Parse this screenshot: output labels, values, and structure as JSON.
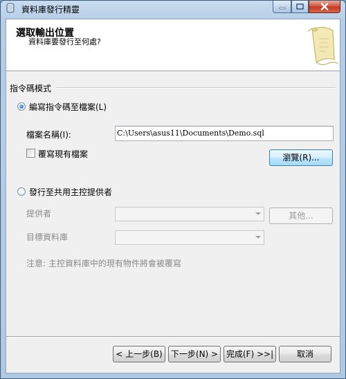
{
  "window": {
    "title": "資料庫發行精靈"
  },
  "header": {
    "title": "選取輸出位置",
    "subtitle": "資料庫要發行至何處?"
  },
  "script_mode": {
    "group_label": "指令碼模式",
    "option_file_label": "編寫指令碼至檔案(L)",
    "file_name_label": "檔案名稱(I):",
    "file_name_value": "C:\\Users\\asus11\\Documents\\Demo.sql",
    "overwrite_label": "覆寫現有檔案",
    "browse_label": "瀏覽(R)...",
    "option_provider_label": "發行至共用主控提供者",
    "provider_label": "提供者",
    "other_label": "其他...",
    "target_db_label": "目標資料庫",
    "note": "注意: 主控資料庫中的現有物件將會被覆寫"
  },
  "footer": {
    "back_label": "< 上一步(B)",
    "next_label": "下一步(N) >",
    "finish_label": "完成(F) >>|",
    "cancel_label": "取消"
  },
  "state": {
    "selected_option": "file",
    "overwrite_checked": false
  }
}
